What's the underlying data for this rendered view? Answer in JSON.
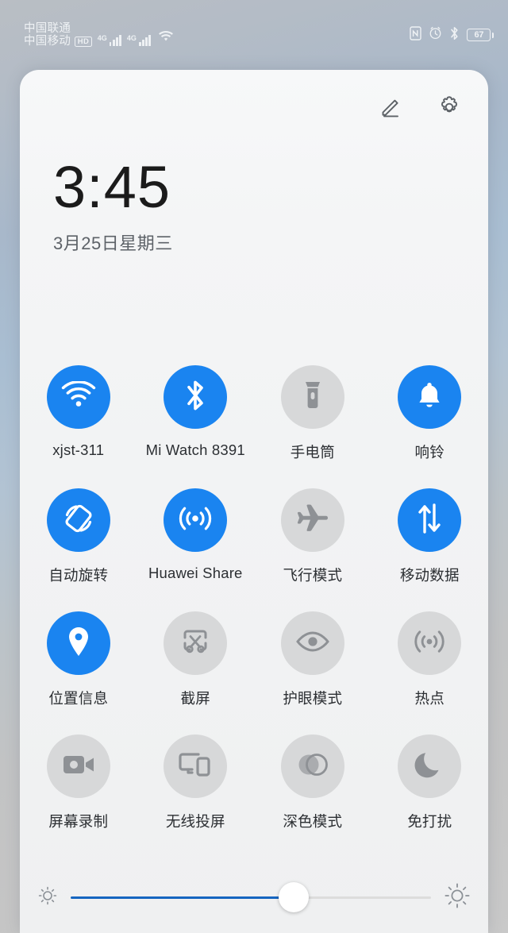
{
  "status_bar": {
    "carrier_primary": "中国联通",
    "carrier_secondary": "中国移动",
    "hd_badge": "HD",
    "network_type_1": "4G",
    "network_type_2": "4G",
    "icons": [
      "nfc-icon",
      "alarm-icon",
      "bluetooth-icon",
      "wifi-icon"
    ],
    "battery_percent": "67"
  },
  "panel": {
    "edit_icon": "pencil-icon",
    "settings_icon": "gear-icon",
    "clock": "3:45",
    "date": "3月25日星期三"
  },
  "toggles": [
    {
      "id": "wifi",
      "label": "xjst-311",
      "icon": "wifi-icon",
      "state": "on"
    },
    {
      "id": "bluetooth",
      "label": "Mi Watch 8391",
      "icon": "bluetooth-icon",
      "state": "on"
    },
    {
      "id": "flashlight",
      "label": "手电筒",
      "icon": "flashlight-icon",
      "state": "off"
    },
    {
      "id": "ring",
      "label": "响铃",
      "icon": "bell-icon",
      "state": "on"
    },
    {
      "id": "auto-rotate",
      "label": "自动旋转",
      "icon": "rotate-icon",
      "state": "on"
    },
    {
      "id": "huawei-share",
      "label": "Huawei Share",
      "icon": "broadcast-icon",
      "state": "on"
    },
    {
      "id": "airplane-mode",
      "label": "飞行模式",
      "icon": "airplane-icon",
      "state": "off"
    },
    {
      "id": "mobile-data",
      "label": "移动数据",
      "icon": "data-arrows-icon",
      "state": "on"
    },
    {
      "id": "location",
      "label": "位置信息",
      "icon": "location-pin-icon",
      "state": "on"
    },
    {
      "id": "screenshot",
      "label": "截屏",
      "icon": "scissors-icon",
      "state": "off"
    },
    {
      "id": "eye-comfort",
      "label": "护眼模式",
      "icon": "eye-icon",
      "state": "off"
    },
    {
      "id": "hotspot",
      "label": "热点",
      "icon": "hotspot-icon",
      "state": "off"
    },
    {
      "id": "screen-record",
      "label": "屏幕录制",
      "icon": "video-camera-icon",
      "state": "off"
    },
    {
      "id": "wireless-cast",
      "label": "无线投屏",
      "icon": "cast-screen-icon",
      "state": "off"
    },
    {
      "id": "dark-mode",
      "label": "深色模式",
      "icon": "dark-mode-icon",
      "state": "off"
    },
    {
      "id": "do-not-disturb",
      "label": "免打扰",
      "icon": "moon-icon",
      "state": "off"
    }
  ],
  "brightness": {
    "low_icon": "sun-small-icon",
    "high_icon": "sun-large-icon",
    "value_percent": 62
  },
  "colors": {
    "accent_on": "#1a84f0",
    "toggle_off": "#d7d8d9",
    "slider_fill": "#1565c0",
    "panel_bg": "#f4f5f6"
  }
}
